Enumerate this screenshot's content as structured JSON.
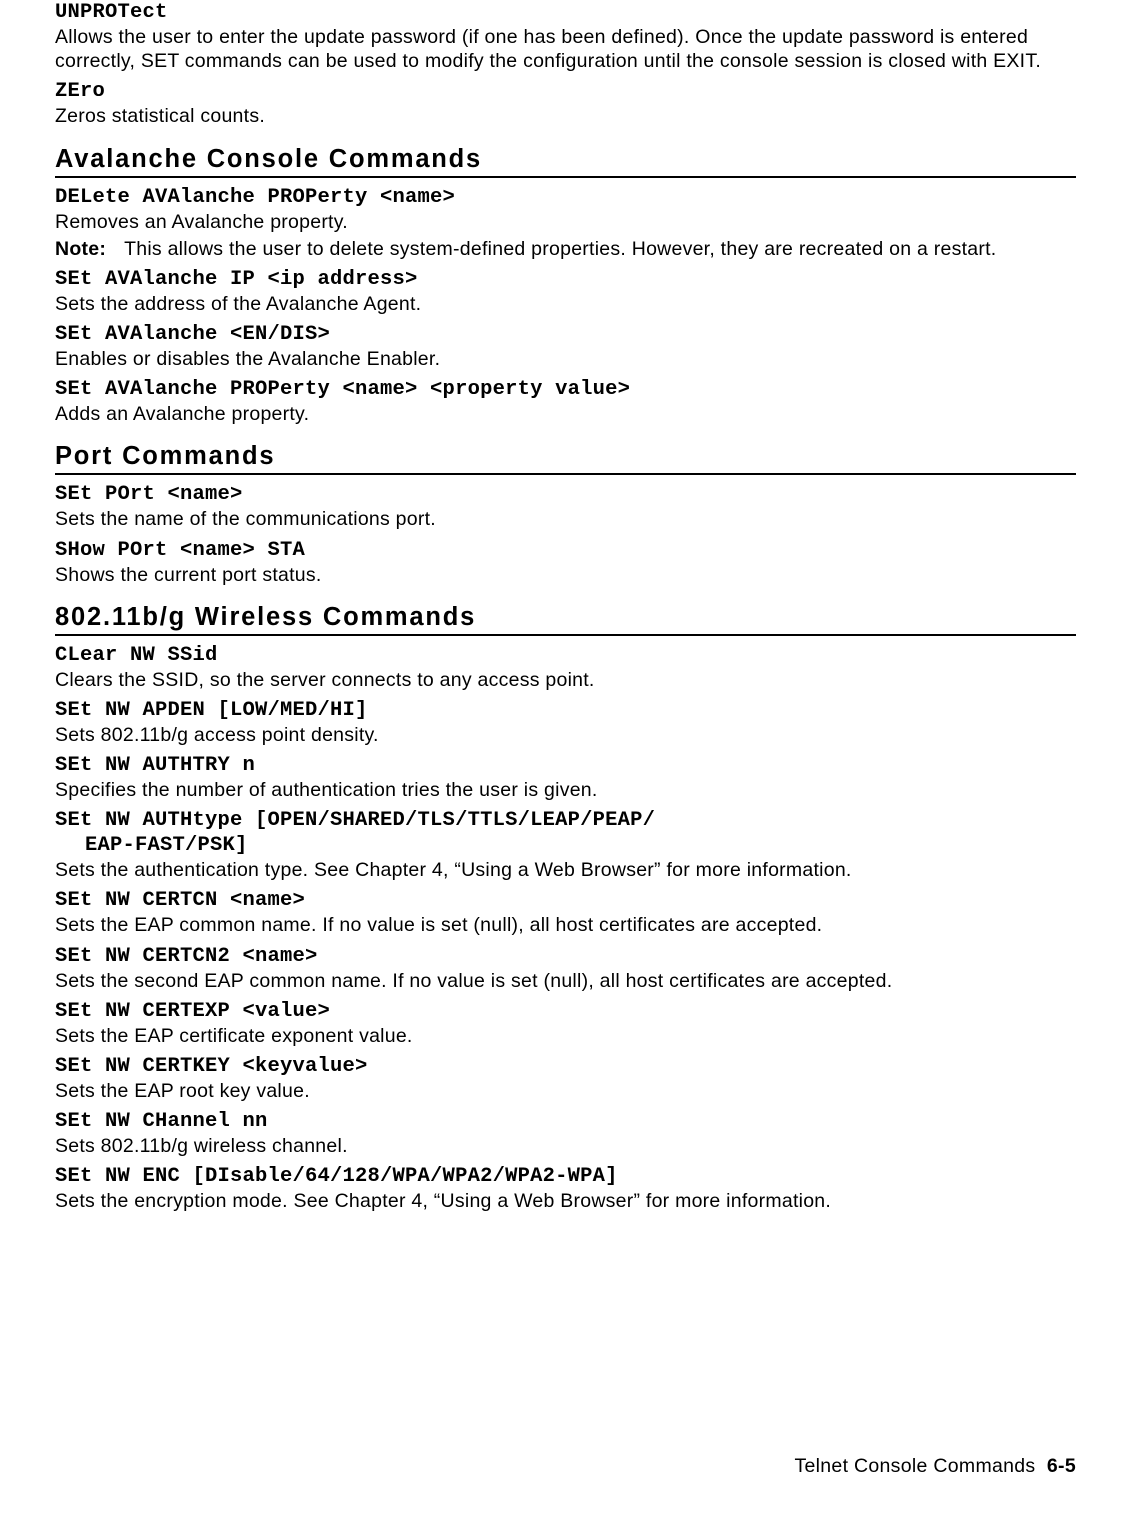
{
  "top": {
    "unprotect": {
      "cmd": "UNPROTect",
      "desc": "Allows the user to enter the update password (if one has been defined).  Once the update password is entered correctly, SET commands can be used to modify the configuration until the console session is closed with EXIT."
    },
    "zero": {
      "cmd": "ZEro",
      "desc": "Zeros statistical counts."
    }
  },
  "avalanche": {
    "heading": "Avalanche Console Commands",
    "delete": {
      "cmd": "DELete AVAlanche PROPerty <name>",
      "desc": "Removes an Avalanche property.",
      "note_label": "Note:",
      "note_body": "This allows the user to delete system-defined properties.  However, they are recreated on a restart."
    },
    "ip": {
      "cmd": "SEt AVAlanche IP <ip address>",
      "desc": "Sets the address of the Avalanche Agent."
    },
    "endis": {
      "cmd": "SEt AVAlanche <EN/DIS>",
      "desc": "Enables or disables the Avalanche Enabler."
    },
    "prop": {
      "cmd": "SEt AVAlanche PROPerty <name> <property value>",
      "desc": "Adds an Avalanche property."
    }
  },
  "port": {
    "heading": "Port Commands",
    "setport": {
      "cmd": "SEt POrt <name>",
      "desc": "Sets the name of the communications port."
    },
    "showport": {
      "cmd": "SHow POrt <name> STA",
      "desc": "Shows the current port status."
    }
  },
  "wireless": {
    "heading": "802.11b/g Wireless Commands",
    "clearssid": {
      "cmd": "CLear NW SSid",
      "desc": "Clears the SSID, so the server connects to any access point."
    },
    "apden": {
      "cmd": "SEt NW APDEN [LOW/MED/HI]",
      "desc": "Sets 802.11b/g access point density."
    },
    "authtry": {
      "cmd": "SEt NW AUTHTRY n",
      "desc": "Specifies the number of authentication tries the user is given."
    },
    "authtype": {
      "cmd_line1": "SEt NW AUTHtype [OPEN/SHARED/TLS/TTLS/LEAP/PEAP/",
      "cmd_line2": "EAP-FAST/PSK]",
      "desc": "Sets the authentication type.  See Chapter 4, “Using a Web Browser” for more information."
    },
    "certcn": {
      "cmd": "SEt NW CERTCN <name>",
      "desc": "Sets the EAP common name.  If no value is set (null), all host certificates are accepted."
    },
    "certcn2": {
      "cmd": "SEt NW CERTCN2 <name>",
      "desc": "Sets the second EAP common name.  If no value is set (null), all host certificates are accepted."
    },
    "certexp": {
      "cmd": "SEt NW CERTEXP <value>",
      "desc": "Sets the EAP certificate exponent value."
    },
    "certkey": {
      "cmd": "SEt NW CERTKEY <keyvalue>",
      "desc": "Sets the EAP root key value."
    },
    "channel": {
      "cmd": "SEt NW CHannel nn",
      "desc": "Sets 802.11b/g wireless channel."
    },
    "enc": {
      "cmd": "SEt NW ENC [DIsable/64/128/WPA/WPA2/WPA2-WPA]",
      "desc": "Sets the encryption mode.  See Chapter 4, “Using a Web Browser” for more information."
    }
  },
  "footer": {
    "text": "Telnet Console Commands",
    "page": "6-5"
  }
}
